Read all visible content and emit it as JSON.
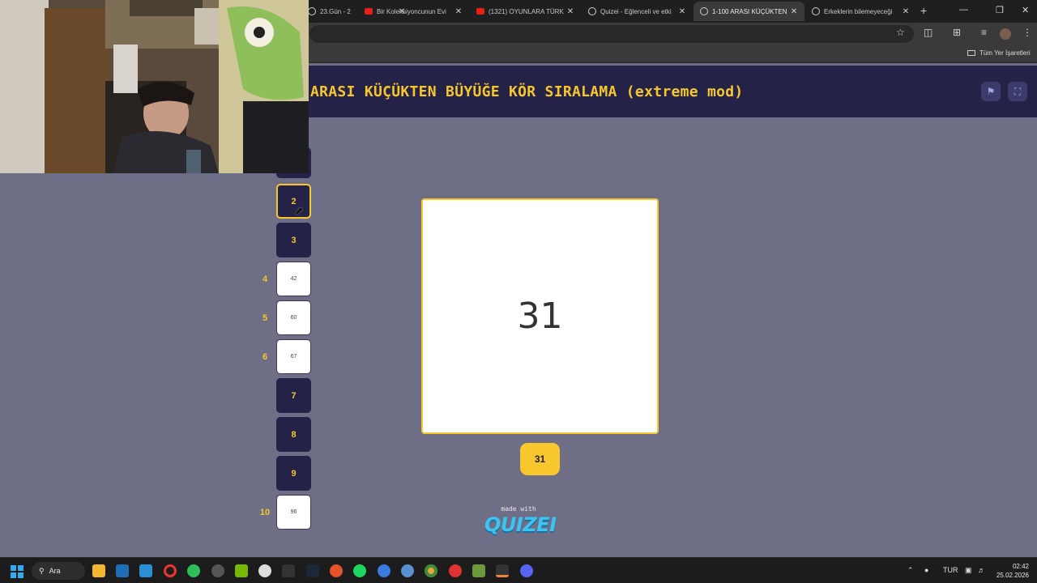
{
  "browser": {
    "tabs": [
      {
        "label": "23.Gün - 2",
        "icon": "globe-icon",
        "active": false
      },
      {
        "label": "Bir Koleksiyoncunun Evi",
        "icon": "youtube-icon",
        "active": false
      },
      {
        "label": "(1321) OYUNLARA TÜRK",
        "icon": "youtube-icon",
        "active": false
      },
      {
        "label": "Quizei - Eğlenceli ve etki",
        "icon": "globe-icon",
        "active": false
      },
      {
        "label": "1-100 ARASI KÜÇÜKTEN",
        "icon": "globe-icon",
        "active": true
      },
      {
        "label": "Erkeklerin bilemeyeceği",
        "icon": "globe-icon",
        "active": false
      }
    ],
    "new_tab": "+",
    "close_glyph": "✕",
    "bookmarks_folder": "Tüm Yer İşaretleri"
  },
  "header": {
    "title": "ARASI KÜÇÜKTEN BÜYÜĞE KÖR SIRALAMA (extreme mod)",
    "flag_icon": "flag-icon",
    "fullscreen_icon": "fullscreen-icon"
  },
  "slots": [
    {
      "rank": "2",
      "value": "",
      "state": "hover"
    },
    {
      "rank": "3",
      "value": "",
      "state": "empty"
    },
    {
      "rank": "4",
      "value": "42",
      "state": "filled"
    },
    {
      "rank": "5",
      "value": "60",
      "state": "filled"
    },
    {
      "rank": "6",
      "value": "67",
      "state": "filled"
    },
    {
      "rank": "7",
      "value": "",
      "state": "empty"
    },
    {
      "rank": "8",
      "value": "",
      "state": "empty"
    },
    {
      "rank": "9",
      "value": "",
      "state": "empty"
    },
    {
      "rank": "10",
      "value": "96",
      "state": "filled"
    }
  ],
  "current": {
    "number": "31",
    "pill": "31"
  },
  "footer": {
    "made_with": "made with",
    "brand": "QUIZEI"
  },
  "taskbar": {
    "search_label": "Ara",
    "language": "TUR",
    "time": "02:42",
    "date": "25.02.2026"
  },
  "colors": {
    "accent": "#f7c72d",
    "header_bg": "#242347",
    "page_bg": "#6e6f86"
  }
}
